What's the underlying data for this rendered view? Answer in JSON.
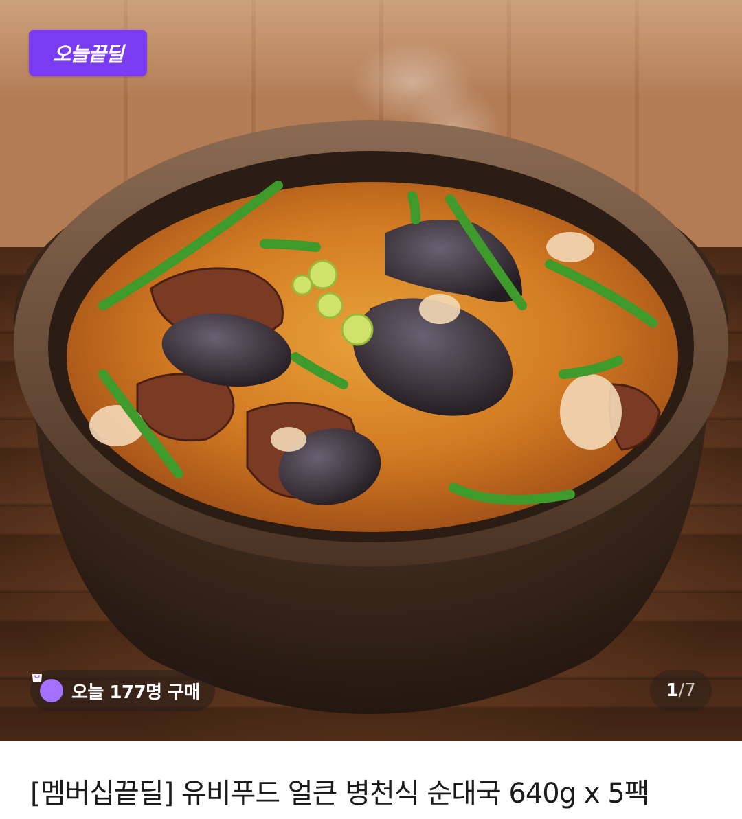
{
  "hero": {
    "badge_label": "오늘끝딜",
    "purchase_text": "오늘 177명 구매",
    "counter_current": "1",
    "counter_separator": "/",
    "counter_total": "7",
    "accent_color": "#7a3cf2"
  },
  "product": {
    "title": "[멤버십끝딜] 유비푸드 얼큰 병천식 순대국 640g x 5팩"
  },
  "icons": {
    "bag": "shopping-bag-icon"
  }
}
